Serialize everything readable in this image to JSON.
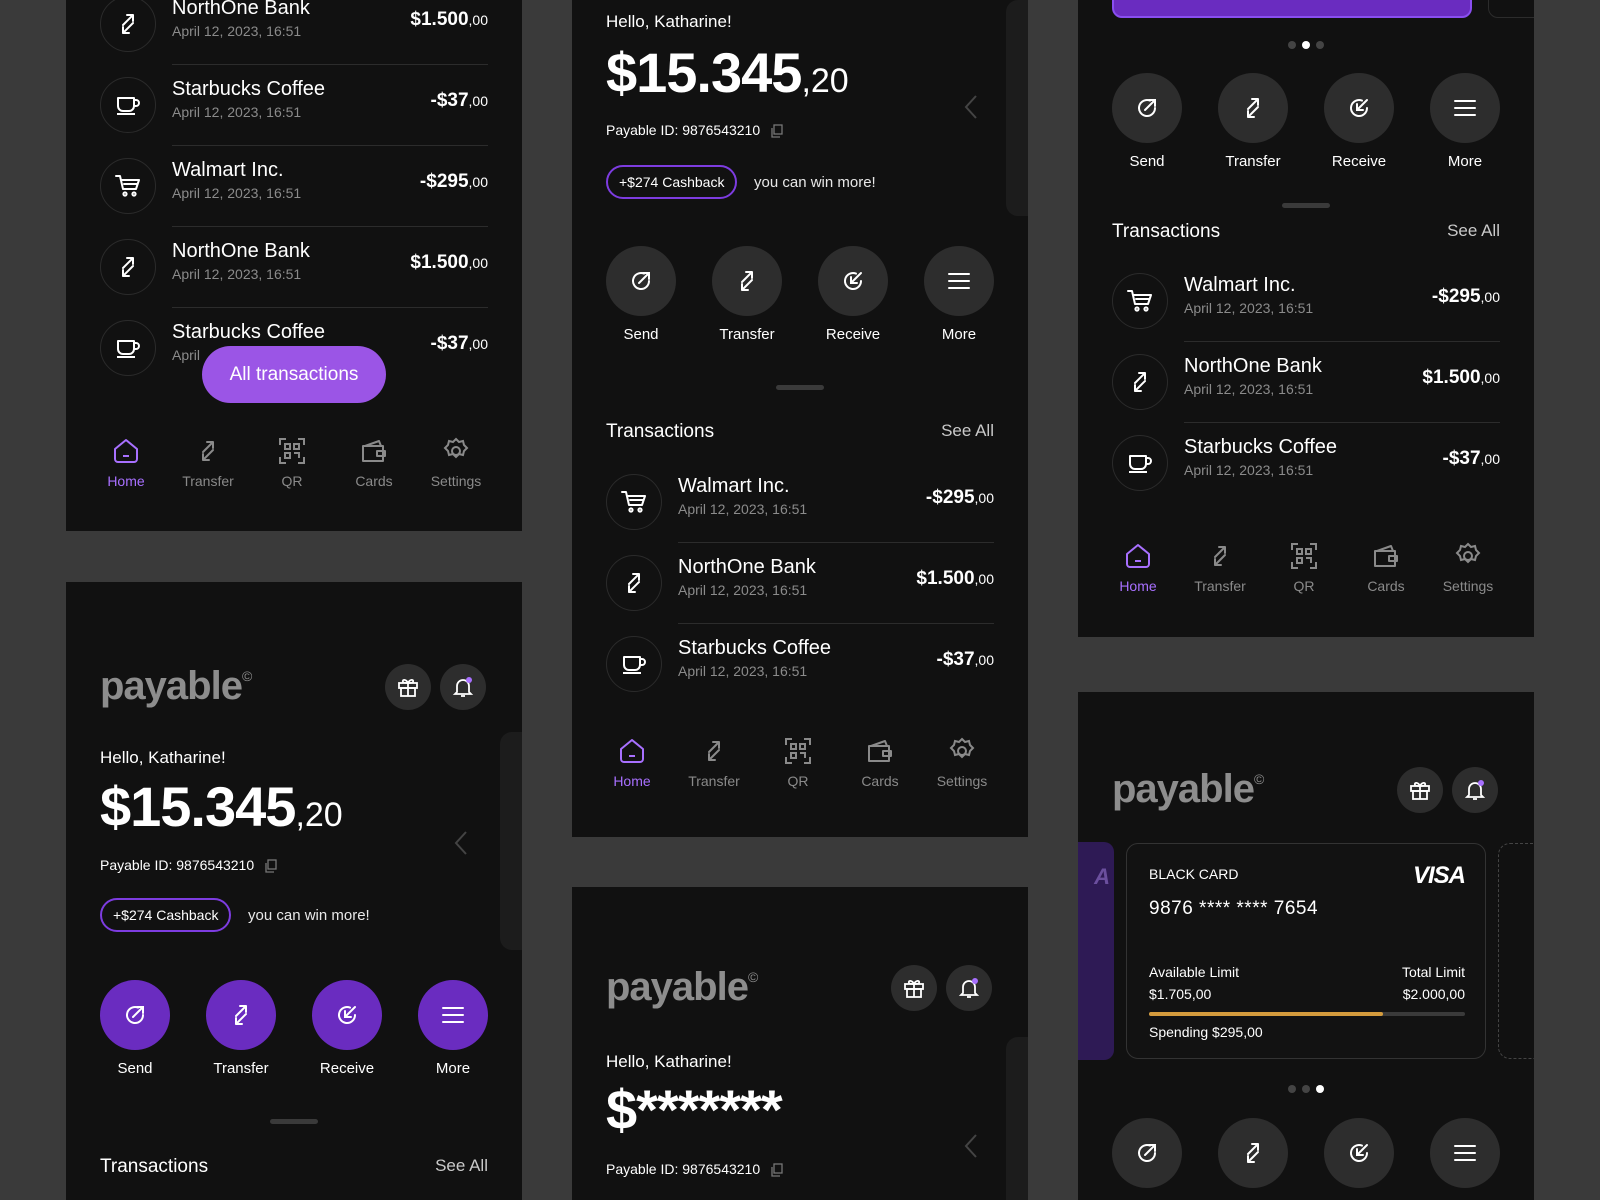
{
  "colors": {
    "accent": "#7d3ce0",
    "accent_light": "#a870ff",
    "screen_bg": "#111111",
    "page_bg": "#3a3a3a",
    "progress": "#d49b3d"
  },
  "common": {
    "greeting": "Hello, Katharine!",
    "balance_main": "$15.345",
    "balance_cents": ",20",
    "balance_hidden": "$*******",
    "payable_id": "Payable ID: 9876543210",
    "cashback": "+$274 Cashback",
    "win_more": "you can win more!",
    "logo": "payable",
    "logo_mark": "©",
    "transactions_title": "Transactions",
    "see_all": "See All",
    "all_transactions": "All transactions"
  },
  "actions": [
    {
      "label": "Send",
      "icon": "send-icon"
    },
    {
      "label": "Transfer",
      "icon": "transfer-icon"
    },
    {
      "label": "Receive",
      "icon": "receive-icon"
    },
    {
      "label": "More",
      "icon": "menu-icon"
    }
  ],
  "nav": [
    {
      "label": "Home",
      "icon": "home-icon"
    },
    {
      "label": "Transfer",
      "icon": "transfer-icon"
    },
    {
      "label": "QR",
      "icon": "qr-icon"
    },
    {
      "label": "Cards",
      "icon": "wallet-icon"
    },
    {
      "label": "Settings",
      "icon": "gear-icon"
    }
  ],
  "tx_list_long": [
    {
      "name": "NorthOne Bank",
      "date": "April 12, 2023, 16:51",
      "amount": "$1.500",
      "cents": ",00",
      "icon": "transfer-icon"
    },
    {
      "name": "Starbucks Coffee",
      "date": "April 12, 2023, 16:51",
      "amount": "-$37",
      "cents": ",00",
      "icon": "coffee-icon"
    },
    {
      "name": "Walmart Inc.",
      "date": "April 12, 2023, 16:51",
      "amount": "-$295",
      "cents": ",00",
      "icon": "cart-icon"
    },
    {
      "name": "NorthOne Bank",
      "date": "April 12, 2023, 16:51",
      "amount": "$1.500",
      "cents": ",00",
      "icon": "transfer-icon"
    },
    {
      "name": "Starbucks Coffee",
      "date": "April",
      "amount": "-$37",
      "cents": ",00",
      "icon": "coffee-icon"
    }
  ],
  "tx_list_short": [
    {
      "name": "Walmart Inc.",
      "date": "April 12, 2023, 16:51",
      "amount": "-$295",
      "cents": ",00",
      "icon": "cart-icon"
    },
    {
      "name": "NorthOne Bank",
      "date": "April 12, 2023, 16:51",
      "amount": "$1.500",
      "cents": ",00",
      "icon": "transfer-icon"
    },
    {
      "name": "Starbucks Coffee",
      "date": "April 12, 2023, 16:51",
      "amount": "-$37",
      "cents": ",00",
      "icon": "coffee-icon"
    }
  ],
  "card": {
    "type": "BLACK CARD",
    "brand": "VISA",
    "number": "9876 **** **** 7654",
    "available_label": "Available Limit",
    "available_value": "$1.705,00",
    "total_label": "Total Limit",
    "total_value": "$2.000,00",
    "spending": "Spending $295,00",
    "limit_used_fraction": 0.74,
    "prev_card_fragment": "A"
  }
}
